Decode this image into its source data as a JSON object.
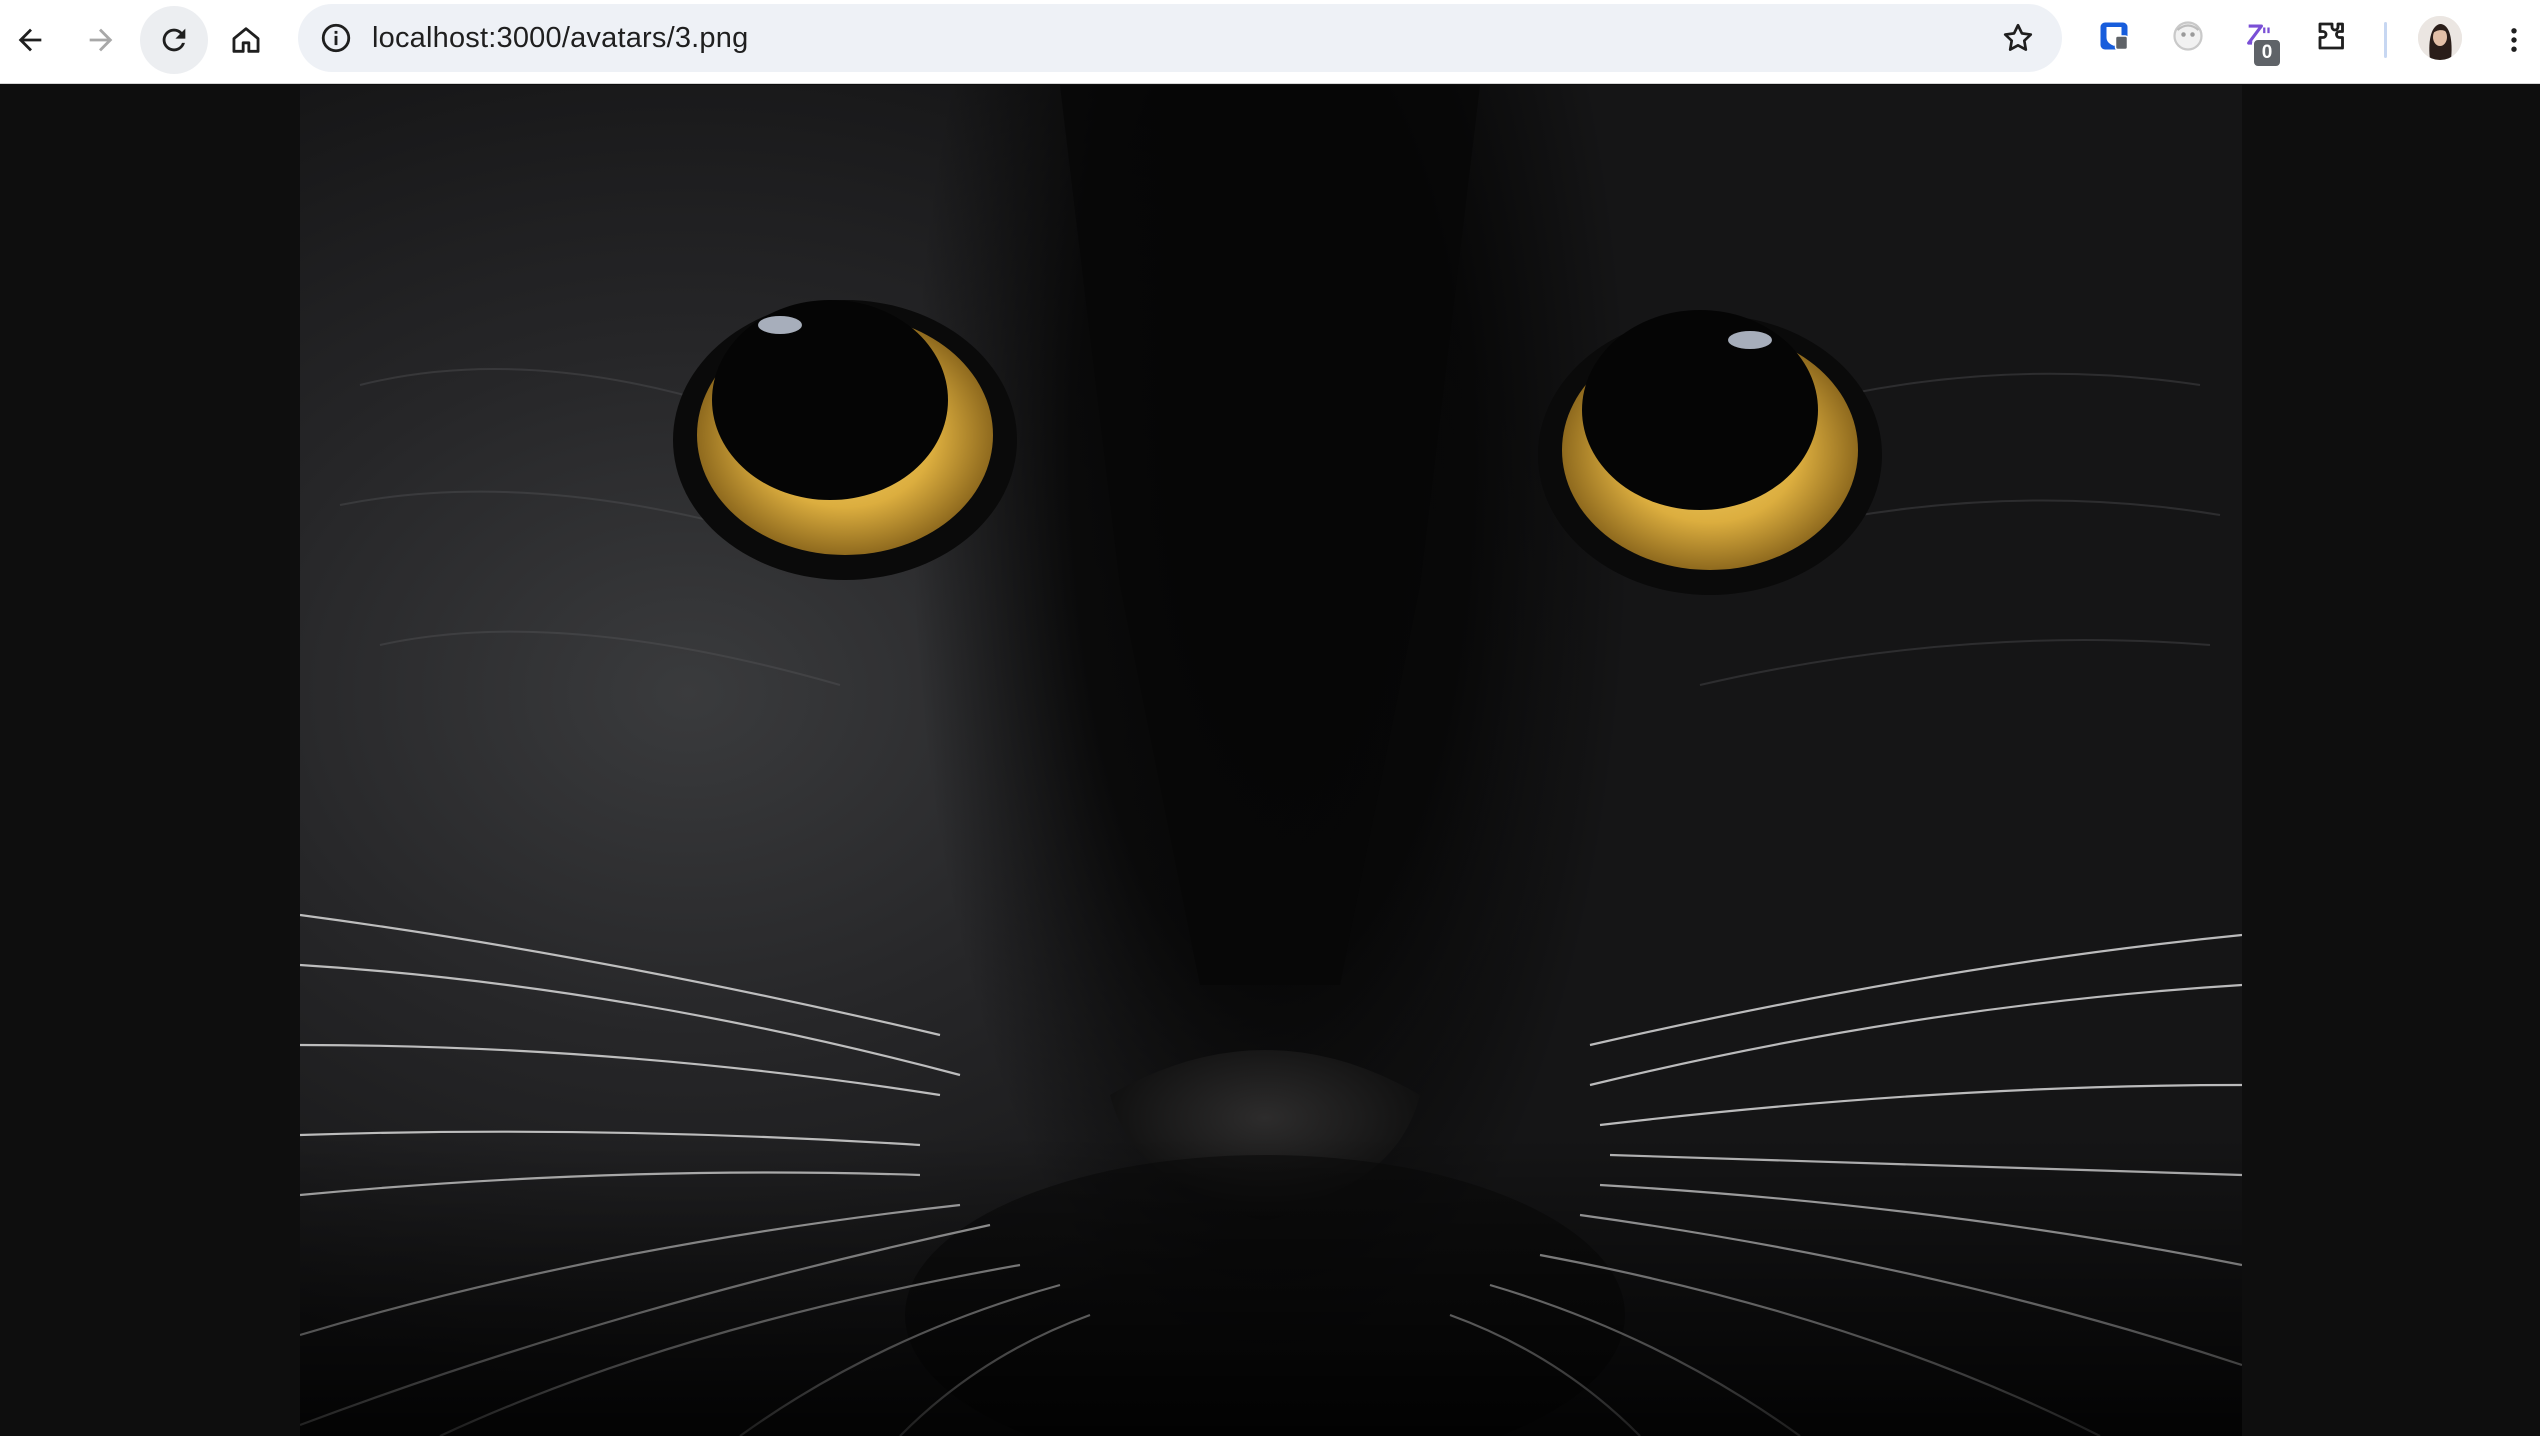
{
  "browser": {
    "url": "localhost:3000/avatars/3.png",
    "extension_badge_count": "0",
    "icons": {
      "back": "arrow-left-icon",
      "forward": "arrow-right-icon",
      "reload": "reload-icon",
      "home": "home-icon",
      "site_info": "info-icon",
      "bookmark": "star-icon",
      "extensions": "puzzle-piece-icon",
      "menu": "three-dots-vertical-icon"
    },
    "colors": {
      "toolbar": "#ffffff",
      "omnibox": "#eef1f6",
      "page_background": "#0e0e0e"
    }
  },
  "image": {
    "subject": "black cat close-up",
    "eye_color": "#d9a93a"
  }
}
